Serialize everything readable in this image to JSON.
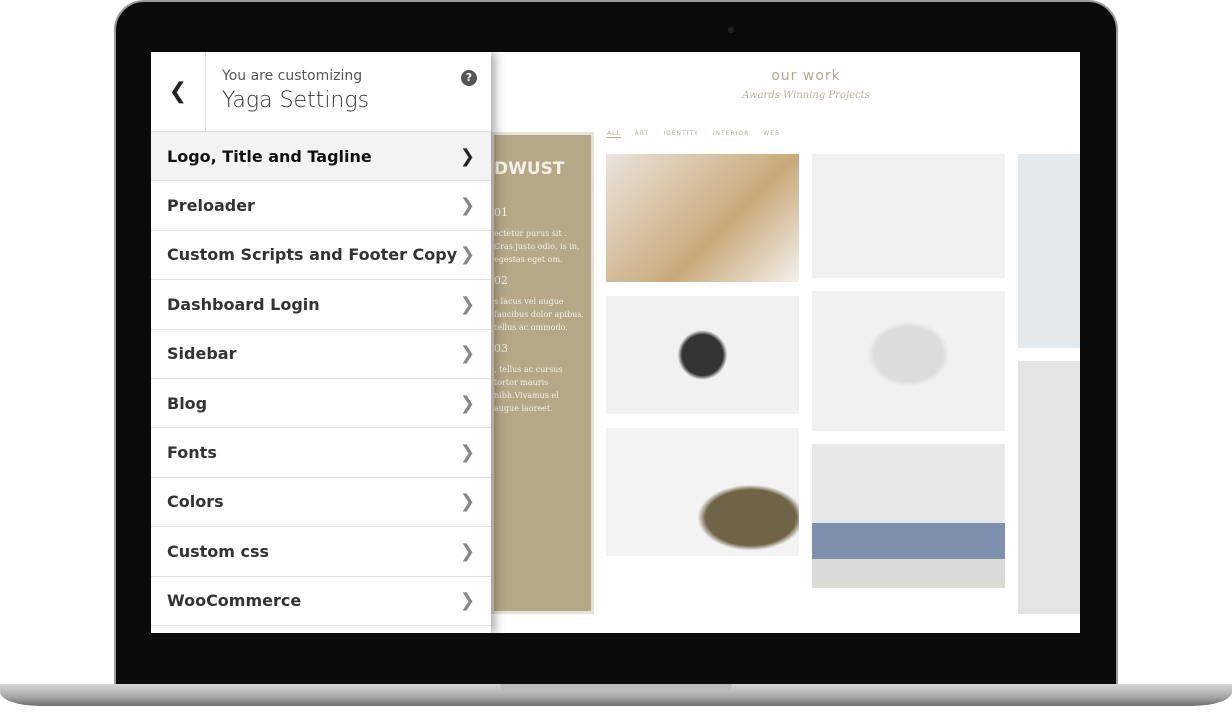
{
  "customizer": {
    "back_icon": "chevron-left-icon",
    "subtitle": "You are customizing",
    "title": "Yaga Settings",
    "help_icon": "question-icon",
    "items": [
      {
        "label": "Logo, Title and Tagline"
      },
      {
        "label": "Preloader"
      },
      {
        "label": "Custom Scripts and Footer Copy"
      },
      {
        "label": "Dashboard Login"
      },
      {
        "label": "Sidebar"
      },
      {
        "label": "Blog"
      },
      {
        "label": "Fonts"
      },
      {
        "label": "Colors"
      },
      {
        "label": "Custom css"
      },
      {
        "label": "WooCommerce"
      }
    ]
  },
  "preview": {
    "heading": "our work",
    "subheading": "Awards Winning Projects",
    "filters": [
      "ALL",
      "ART",
      "IDENTITY",
      "INTERIOR",
      "WEB"
    ],
    "sidebar": {
      "logo": "DWUST",
      "n1": "01",
      "t1": "ectetur purus sit . Cras justo odio, is in, egestas eget om.",
      "n2": "02",
      "t2": "s lacus vel augue faucibus dolor apibus, tellus ac ommodo.",
      "n3": "03",
      "t3": ", tellus ac cursus tortor mauris nibh.Vivamus el augue laoreet."
    }
  },
  "colors": {
    "accent": "#b4a887"
  }
}
